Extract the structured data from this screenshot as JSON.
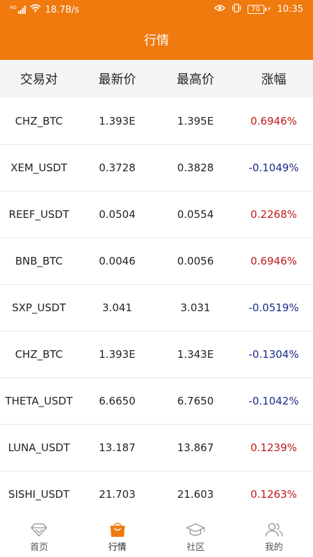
{
  "status_bar": {
    "network_tag": "4G",
    "speed": "18.7B/s",
    "battery": "70",
    "time": "10:35"
  },
  "header": {
    "title": "行情"
  },
  "table": {
    "columns": [
      "交易对",
      "最新价",
      "最高价",
      "涨幅"
    ],
    "rows": [
      {
        "pair": "CHZ_BTC",
        "latest": "1.393E",
        "high": "1.395E",
        "change": "0.6946%",
        "trend": "up"
      },
      {
        "pair": "XEM_USDT",
        "latest": "0.3728",
        "high": "0.3828",
        "change": "-0.1049%",
        "trend": "down"
      },
      {
        "pair": "REEF_USDT",
        "latest": "0.0504",
        "high": "0.0554",
        "change": "0.2268%",
        "trend": "up"
      },
      {
        "pair": "BNB_BTC",
        "latest": "0.0046",
        "high": "0.0056",
        "change": "0.6946%",
        "trend": "up"
      },
      {
        "pair": "SXP_USDT",
        "latest": "3.041",
        "high": "3.031",
        "change": "-0.0519%",
        "trend": "down"
      },
      {
        "pair": "CHZ_BTC",
        "latest": "1.393E",
        "high": "1.343E",
        "change": "-0.1304%",
        "trend": "down"
      },
      {
        "pair": "THETA_USDT",
        "latest": "6.6650",
        "high": "6.7650",
        "change": "-0.1042%",
        "trend": "down"
      },
      {
        "pair": "LUNA_USDT",
        "latest": "13.187",
        "high": "13.867",
        "change": "0.1239%",
        "trend": "up"
      },
      {
        "pair": "SISHI_USDT",
        "latest": "21.703",
        "high": "21.603",
        "change": "0.1263%",
        "trend": "up"
      }
    ]
  },
  "bottom_nav": {
    "items": [
      {
        "label": "首页",
        "icon": "diamond-icon",
        "active": false
      },
      {
        "label": "行情",
        "icon": "shopping-bag-icon",
        "active": true
      },
      {
        "label": "社区",
        "icon": "graduation-cap-icon",
        "active": false
      },
      {
        "label": "我的",
        "icon": "user-icon",
        "active": false
      }
    ]
  },
  "colors": {
    "accent": "#f07a0e",
    "up": "#c01818",
    "down": "#1a2a8a",
    "inactive_icon": "#9a9a9a"
  }
}
